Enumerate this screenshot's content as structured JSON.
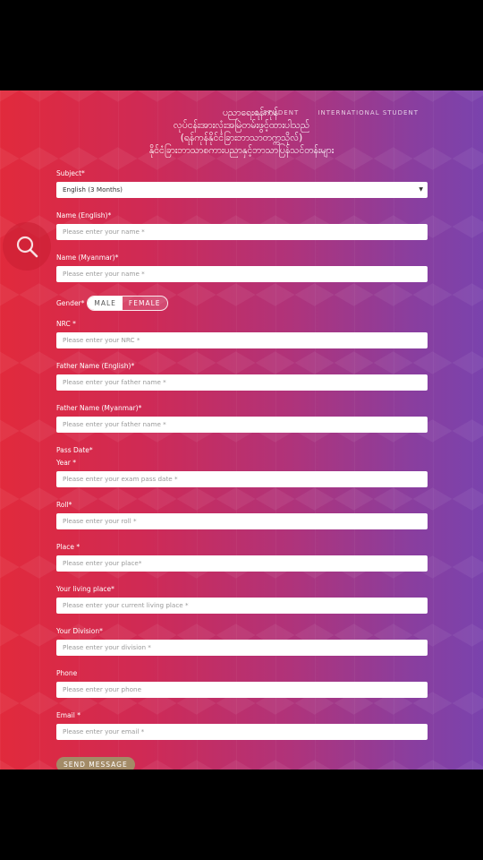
{
  "header": {
    "myanmar_lines": [
      "ပညာရေးရန်ကုန်",
      "လုပ်ငန်းအားလုံးအမြဲတမ်းဖွင့်ထားပါသည်",
      "(ရန်ကုန်နိုင်ငံခြားဘာသာတက္ကသိုလ်)",
      "နိုင်ငံခြားဘာသာစကားပညာနှင့်ဘာသာပြန်သင်တန်းများ"
    ],
    "nav": [
      "L STUDENT",
      "INTERNATIONAL STUDENT"
    ]
  },
  "form": {
    "subject": {
      "label": "Subject*",
      "value": "English (3 Months)"
    },
    "name_en": {
      "label": "Name (English)*",
      "placeholder": "Please enter your name *"
    },
    "name_my": {
      "label": "Name (Myanmar)*",
      "placeholder": "Please enter your name *"
    },
    "gender": {
      "label": "Gender*",
      "options": [
        "MALE",
        "FEMALE"
      ],
      "selected": "MALE"
    },
    "nrc": {
      "label": "NRC *",
      "placeholder": "Please enter your NRC *"
    },
    "father_en": {
      "label": "Father Name (English)*",
      "placeholder": "Please enter your father name *"
    },
    "father_my": {
      "label": "Father Name (Myanmar)*",
      "placeholder": "Please enter your father name *"
    },
    "pass_date": {
      "label": "Pass Date*"
    },
    "year": {
      "label": "Year *",
      "placeholder": "Please enter your exam pass date *"
    },
    "roll": {
      "label": "Roll*",
      "placeholder": "Please enter your roll *"
    },
    "place": {
      "label": "Place *",
      "placeholder": "Please enter your place*"
    },
    "living_place": {
      "label": "Your living place*",
      "placeholder": "Please enter your current living place *"
    },
    "division": {
      "label": "Your Division*",
      "placeholder": "Please enter your division *"
    },
    "phone": {
      "label": "Phone",
      "placeholder": "Please enter your phone"
    },
    "email": {
      "label": "Email *",
      "placeholder": "Please enter your email *"
    },
    "submit_label": "SEND MESSAGE"
  },
  "colors": {
    "accent": "#a38b67",
    "gradient_left": "#e12a3c",
    "gradient_right": "#7a43ad"
  },
  "icons": {
    "search": "search-icon"
  }
}
